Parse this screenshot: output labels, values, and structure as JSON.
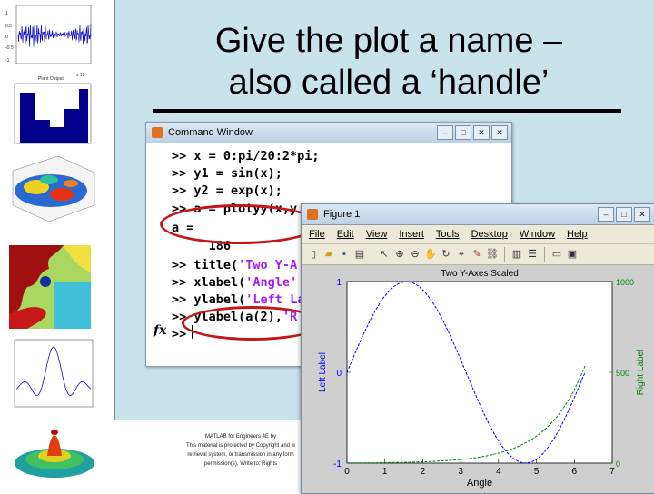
{
  "slide": {
    "title_line1": "Give the plot a name –",
    "title_line2": "also called a ‘handle’",
    "credits": [
      "MATLAB for Engineers 4E by",
      "This material is protected by Copyright and w",
      "retrieval system, or transmission in any form",
      "permission(s), Write to: Rights"
    ]
  },
  "thumbnails": {
    "thumb1_axis": [
      "1",
      "0.5",
      "0",
      "-0.5",
      "-1"
    ],
    "thumb2_title": "Plant Output",
    "thumb2_label": "x 10"
  },
  "command_window": {
    "title": "Command Window",
    "buttons": [
      "‒",
      "□",
      "✕",
      "✕"
    ],
    "lines": [
      {
        "prompt": ">> ",
        "code": "x = 0:pi/20:2*pi;",
        "str": ""
      },
      {
        "prompt": ">> ",
        "code": "y1 = sin(x);",
        "str": ""
      },
      {
        "prompt": ">> ",
        "code": "y2 = exp(x);",
        "str": ""
      },
      {
        "prompt": ">> ",
        "code": "a = plotyy(x,y",
        "str": ""
      },
      {
        "prompt": "",
        "code": "a =",
        "str": ""
      },
      {
        "prompt": "",
        "code": "     186",
        "str": ""
      },
      {
        "prompt": ">> ",
        "code": "title(",
        "str": "'Two Y-A"
      },
      {
        "prompt": ">> ",
        "code": "xlabel(",
        "str": "'Angle'"
      },
      {
        "prompt": ">> ",
        "code": "ylabel(",
        "str": "'Left La"
      },
      {
        "prompt": ">> ",
        "code": "ylabel(a(2),",
        "str": "'R"
      },
      {
        "prompt": ">> ",
        "code": "",
        "str": ""
      }
    ],
    "fx": "fx"
  },
  "figure_window": {
    "title": "Figure 1",
    "buttons": [
      "‒",
      "□",
      "✕"
    ],
    "menus": [
      "File",
      "Edit",
      "View",
      "Insert",
      "Tools",
      "Desktop",
      "Window",
      "Help"
    ],
    "tools": [
      "new-file-icon",
      "open-folder-icon",
      "save-icon",
      "print-icon",
      "arrow-icon",
      "zoom-in-icon",
      "zoom-out-icon",
      "pan-icon",
      "rotate-icon",
      "data-cursor-icon",
      "brush-icon",
      "link-icon",
      "colorbar-icon",
      "legend-icon",
      "hide-tools-icon",
      "show-tools-icon"
    ]
  },
  "chart_data": {
    "type": "line",
    "title": "Two Y-Axes Scaled",
    "xlabel": "Angle",
    "ylabel_left": "Left Label",
    "ylabel_right": "Right Label",
    "xlim": [
      0,
      7
    ],
    "ylim_left": [
      -1,
      1
    ],
    "ylim_right": [
      0,
      1000
    ],
    "x_ticks": [
      "0",
      "1",
      "2",
      "3",
      "4",
      "5",
      "6",
      "7"
    ],
    "left_ticks": [
      "1",
      "0",
      "-1"
    ],
    "right_ticks": [
      "1000",
      "500",
      "0"
    ],
    "series": [
      {
        "axis": "left",
        "color": "#0000ff",
        "function": "sin",
        "x_range": [
          0,
          6.2832
        ]
      },
      {
        "axis": "right",
        "color": "#008000",
        "function": "exp",
        "x_range": [
          0,
          6.2832
        ]
      }
    ],
    "grid": false
  }
}
